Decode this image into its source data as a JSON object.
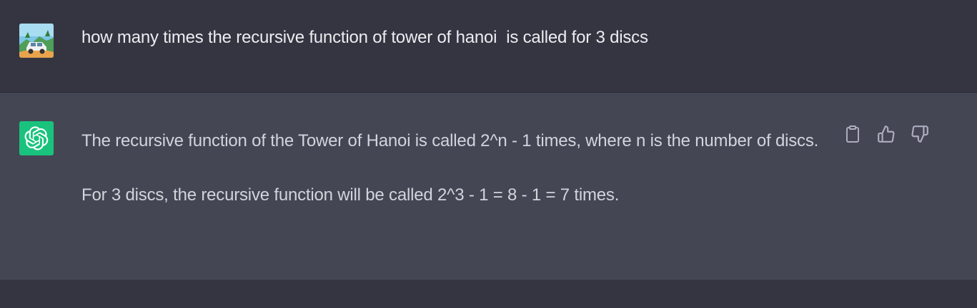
{
  "user_message": {
    "avatar_icon": "user-avatar-car-image",
    "text": "how many times the recursive function of tower of hanoi  is called for 3 discs"
  },
  "assistant_message": {
    "avatar_icon": "openai-logo-icon",
    "avatar_color": "#19c37d",
    "paragraphs": [
      "The recursive function of the Tower of Hanoi is called 2^n - 1 times, where n is the number of discs.",
      "For 3 discs, the recursive function will be called 2^3 - 1 = 8 - 1 = 7 times."
    ],
    "actions": [
      "clipboard-icon",
      "thumbs-up-icon",
      "thumbs-down-icon"
    ]
  },
  "colors": {
    "user_bg": "#343541",
    "assistant_bg": "#444654",
    "text": "#d1d5db",
    "icon": "#acacbe"
  }
}
